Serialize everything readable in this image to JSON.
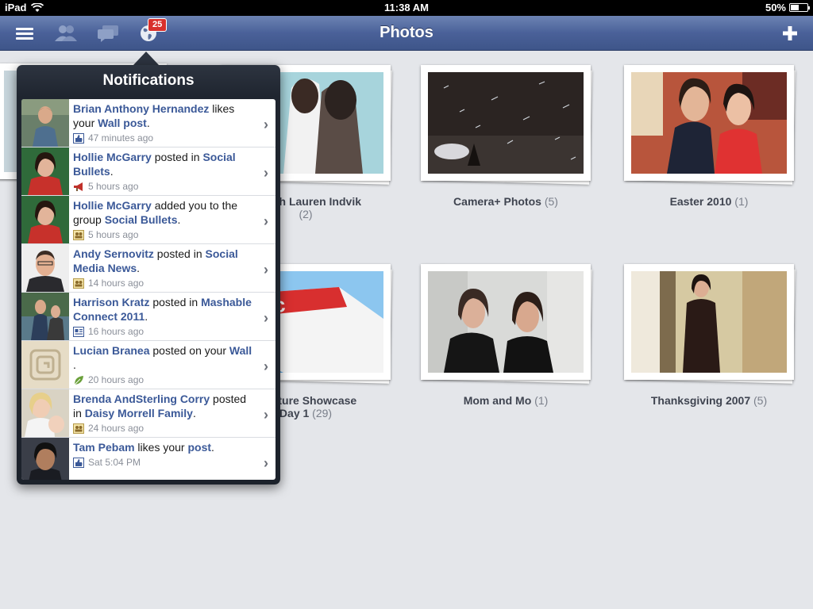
{
  "status_bar": {
    "device": "iPad",
    "time": "11:38 AM",
    "battery": "50%",
    "battery_level": 0.5
  },
  "nav": {
    "title": "Photos",
    "notifications_count": "25",
    "add_label": "+"
  },
  "albums": [
    {
      "title": "nt with Lauren Indvik",
      "count": "(2)"
    },
    {
      "title": "Camera+ Photos",
      "count": "(5)"
    },
    {
      "title": "Easter 2010",
      "count": "(1)"
    },
    {
      "title": "t Picture Showcase",
      "title2": "Day 1",
      "count": "(29)"
    },
    {
      "title": "Mom and Mo",
      "count": "(1)"
    },
    {
      "title": "Thanksgiving 2007",
      "count": "(5)"
    }
  ],
  "popover": {
    "title": "Notifications",
    "items": [
      {
        "name": "Brian Anthony Hernandez",
        "text1": " likes your ",
        "link": "Wall post",
        "text2": ".",
        "time": "47 minutes ago",
        "icon": "like-icon"
      },
      {
        "name": "Hollie McGarry",
        "text1": " posted in ",
        "link": "Social Bullets",
        "text2": ".",
        "time": "5 hours ago",
        "icon": "megaphone-icon"
      },
      {
        "name": "Hollie McGarry",
        "text1": " added you to the group ",
        "link": "Social Bullets",
        "text2": ".",
        "time": "5 hours ago",
        "icon": "group-icon"
      },
      {
        "name": "Andy Sernovitz",
        "text1": " posted in ",
        "link": "Social Media News",
        "text2": ".",
        "time": "14 hours ago",
        "icon": "group-icon"
      },
      {
        "name": "Harrison Kratz",
        "text1": " posted in ",
        "link": "Mashable Connect 2011",
        "text2": ".",
        "time": "16 hours ago",
        "icon": "page-icon"
      },
      {
        "name": "Lucian Branea",
        "text1": " posted on your ",
        "link": "Wall",
        "text2": ".",
        "time": "20 hours ago",
        "icon": "leaf-icon"
      },
      {
        "name": "Brenda AndSterling Corry",
        "text1": " posted in ",
        "link": "Daisy Morrell Family",
        "text2": ".",
        "time": "24 hours ago",
        "icon": "group-icon"
      },
      {
        "name": "Tam Pebam",
        "text1": " likes your ",
        "link": "post",
        "text2": ".",
        "time": "Sat 5:04 PM",
        "icon": "like-icon"
      }
    ]
  }
}
